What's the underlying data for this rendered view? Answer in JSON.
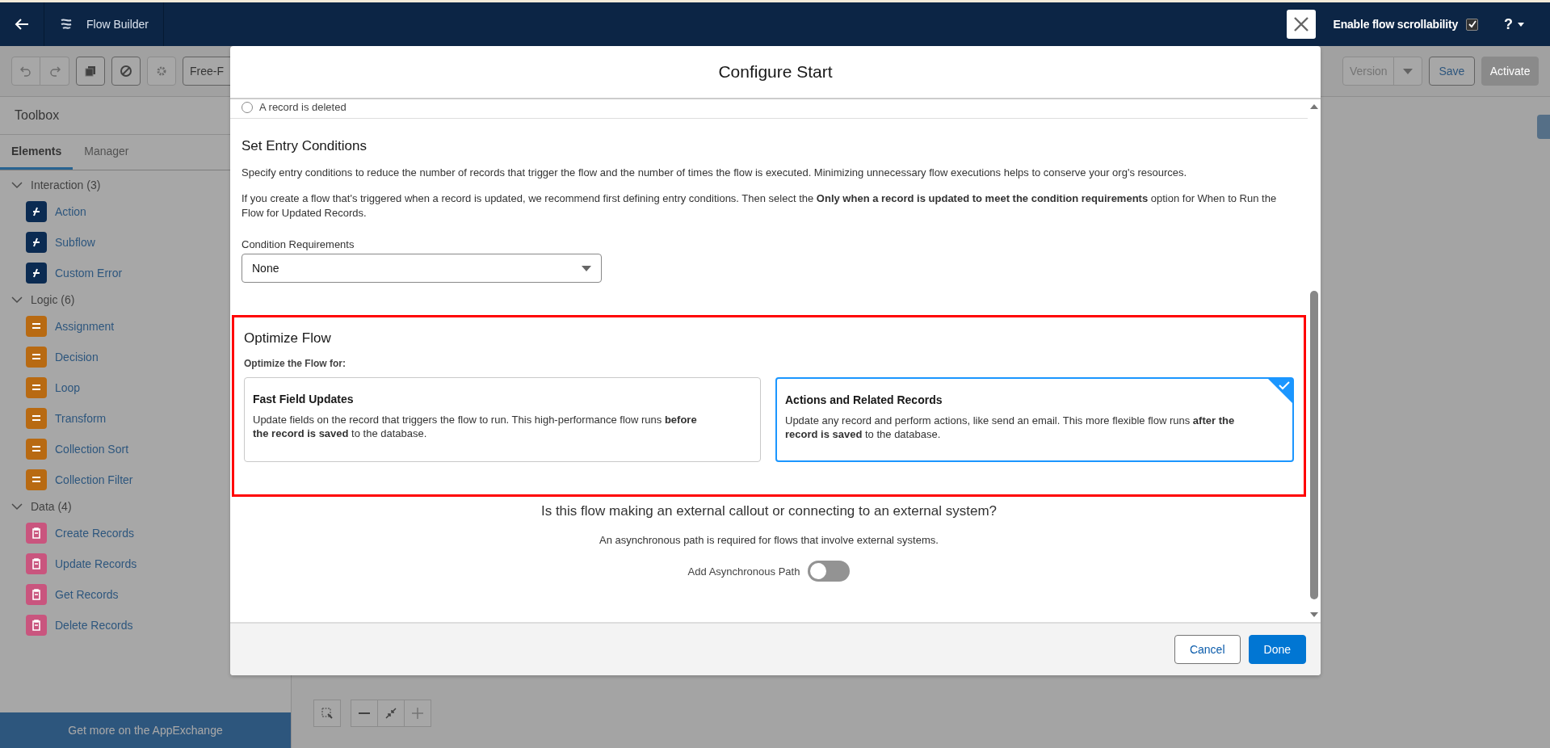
{
  "top_bar": {
    "app_title": "Flow Builder",
    "scroll_option": {
      "label": "Enable flow scrollability",
      "checked": true
    },
    "help": "?"
  },
  "toolbar": {
    "mode": "Free-F",
    "version": "Version",
    "save": "Save",
    "activate": {
      "label": "Activate",
      "disabled": true
    }
  },
  "toolbox": {
    "title": "Toolbox",
    "tabs": [
      {
        "label": "Elements",
        "selected": true
      },
      {
        "label": "Manager",
        "selected": false
      }
    ],
    "groups": [
      {
        "label": "Interaction (3)",
        "expanded": true,
        "color": "#0b2b52",
        "items": [
          "Action",
          "Subflow",
          "Custom Error"
        ]
      },
      {
        "label": "Logic (6)",
        "expanded": true,
        "color": "#b86a12",
        "items": [
          "Assignment",
          "Decision",
          "Loop",
          "Transform",
          "Collection Sort",
          "Collection Filter"
        ]
      },
      {
        "label": "Data (4)",
        "expanded": true,
        "color": "#c9557e",
        "items": [
          "Create Records",
          "Update Records",
          "Get Records",
          "Delete Records"
        ]
      }
    ],
    "footer_link": "Get more on the AppExchange"
  },
  "modal": {
    "title": "Configure Start",
    "trigger_option": {
      "label": "A record is deleted",
      "selected": false
    },
    "entry_conditions": {
      "heading": "Set Entry Conditions",
      "paragraphs": [
        "Specify entry conditions to reduce the number of records that trigger the flow and the number of times the flow is executed. Minimizing unnecessary flow executions helps to conserve your org's resources.",
        "If you create a flow that's triggered when a record is updated, we recommend first defining entry conditions. Then select the **Only when a record is updated to meet the condition requirements** option for When to Run the Flow for Updated Records."
      ],
      "field_label": "Condition Requirements",
      "field_value": "None"
    },
    "optimize": {
      "highlighted": true,
      "heading": "Optimize Flow",
      "subheading": "Optimize the Flow for:",
      "options": [
        {
          "title": "Fast Field Updates",
          "description": "Update fields on the record that triggers the flow to run. This high-performance flow runs **before the record is saved** to the database.",
          "selected": false
        },
        {
          "title": "Actions and Related Records",
          "description": "Update any record and perform actions, like send an email. This more flexible flow runs **after the record is saved** to the database.",
          "selected": true
        }
      ]
    },
    "async": {
      "question": "Is this flow making an external callout or connecting to an external system?",
      "note": "An asynchronous path is required for flows that involve external systems.",
      "toggle": {
        "label": "Add Asynchronous Path",
        "on": false
      }
    },
    "buttons": {
      "cancel": "Cancel",
      "done": "Done"
    }
  }
}
